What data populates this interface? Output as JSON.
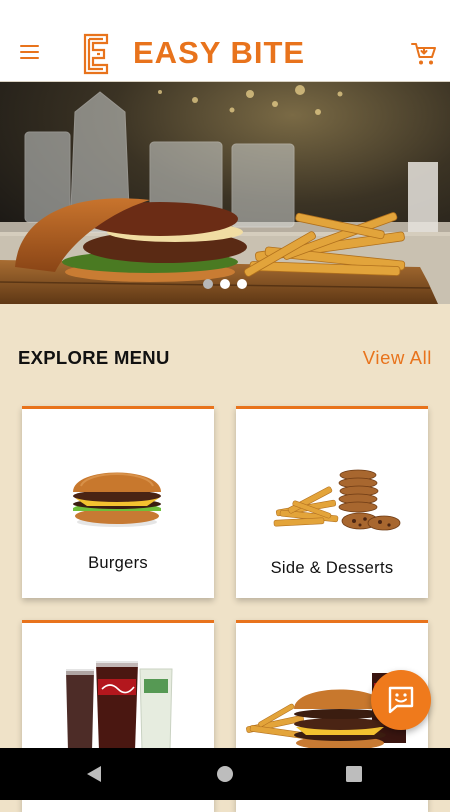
{
  "app": {
    "brand_name": "EASY BITE",
    "brand_color": "#e8731c",
    "background_color": "#efe2c8"
  },
  "header": {
    "menu_icon": "hamburger-menu-icon",
    "cart_icon": "shopping-cart-icon"
  },
  "hero": {
    "image": "burger-and-fries-photo",
    "slide_count": 3,
    "active_slide": 2
  },
  "explore": {
    "title": "EXPLORE MENU",
    "view_all_label": "View All"
  },
  "categories": [
    {
      "label": "Burgers",
      "image": "burger-image"
    },
    {
      "label": "Side & Desserts",
      "image": "fries-and-cookies-image"
    },
    {
      "label": "",
      "image": "soft-drinks-image"
    },
    {
      "label": "",
      "image": "burger-combo-image"
    }
  ],
  "fab": {
    "icon": "chat-support-icon"
  },
  "system_nav": {
    "back_icon": "back-triangle-icon",
    "home_icon": "home-circle-icon",
    "recents_icon": "recents-square-icon"
  }
}
